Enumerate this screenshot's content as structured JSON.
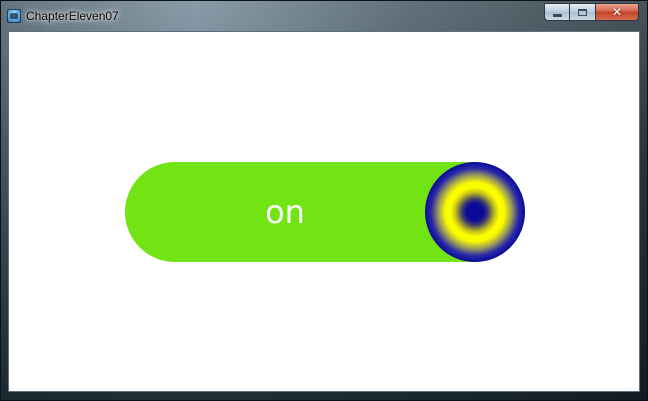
{
  "window": {
    "title": "ChapterEleven07",
    "app_icon": "app-icon",
    "buttons": {
      "minimize_icon": "minimize-icon",
      "maximize_icon": "maximize-icon",
      "close_glyph": "✕"
    }
  },
  "toggle": {
    "label": "on",
    "state": "on",
    "track_color": "#72e313",
    "label_color": "#ffffff",
    "knob_colors": {
      "center": "#0a0a9a",
      "ring": "#ffff00",
      "edge": "#0a0a98"
    }
  }
}
